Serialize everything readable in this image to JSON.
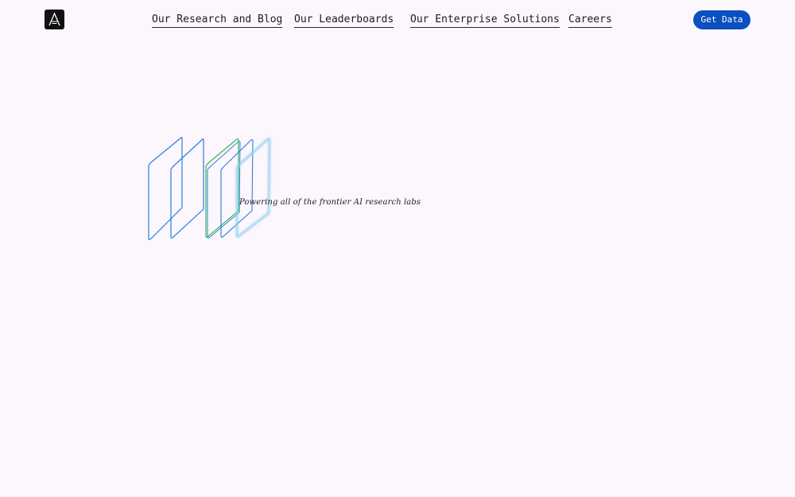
{
  "header": {
    "logo_icon": "logo-a-mark",
    "nav": [
      {
        "label": "Our Research and Blog"
      },
      {
        "label": "Our Leaderboards"
      },
      {
        "label": "Our Enterprise Solutions"
      },
      {
        "label": "Careers"
      }
    ],
    "cta_label": "Get Data"
  },
  "hero": {
    "tagline": "Powering all of the frontier AI research labs"
  },
  "colors": {
    "background": "#fcf6fd",
    "cta": "#0b4fc1",
    "panel_blue": "#2a7fe0",
    "panel_green": "#39b84a",
    "panel_glow": "#8fd0ee"
  }
}
